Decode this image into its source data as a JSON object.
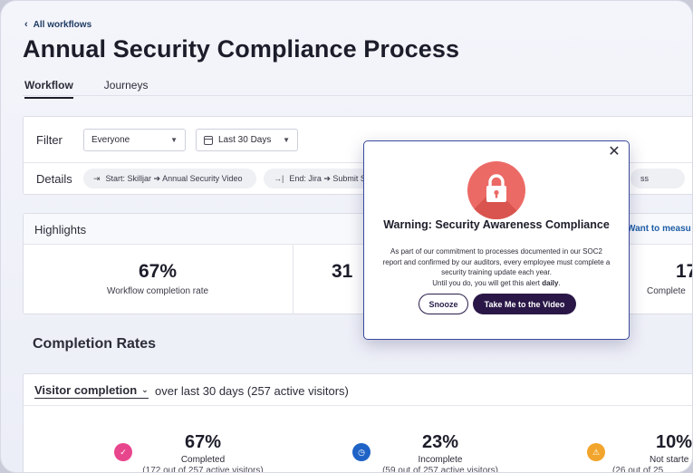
{
  "header": {
    "back_link": "All workflows",
    "title": "Annual Security Compliance Process",
    "tabs": [
      {
        "label": "Workflow",
        "active": true
      },
      {
        "label": "Journeys",
        "active": false
      }
    ]
  },
  "filter": {
    "label": "Filter",
    "audience": "Everyone",
    "date_range": "Last 30 Days",
    "details_label": "Details",
    "chips": [
      {
        "icon": "start-arrow-icon",
        "text": "Start: Skilljar ➔ Annual Security Video"
      },
      {
        "icon": "end-arrow-icon",
        "text": "End: Jira ➔ Submit S"
      },
      {
        "icon": "",
        "text": "ss"
      }
    ]
  },
  "highlights": {
    "title": "Highlights",
    "link": "Want to measu",
    "stats": [
      {
        "value": "67%",
        "label": "Workflow completion rate"
      },
      {
        "value": "31",
        "label": ""
      },
      {
        "value": "17",
        "label": "Complete"
      }
    ]
  },
  "completion": {
    "section_title": "Completion Rates",
    "metric_select": "Visitor completion",
    "description": "over last 30 days (257 active visitors)",
    "stats": [
      {
        "value": "67%",
        "label": "Completed",
        "sub": "(172 out of 257 active visitors)",
        "icon": "check-circle-icon",
        "color": "#e8468c"
      },
      {
        "value": "23%",
        "label": "Incomplete",
        "sub": "(59 out of 257 active visitors)",
        "icon": "clock-icon",
        "color": "#1f63c6"
      },
      {
        "value": "10%",
        "label": "Not starte",
        "sub": "(26 out of 25",
        "icon": "warning-icon",
        "color": "#f2a52c"
      }
    ]
  },
  "modal": {
    "title": "Warning: Security Awareness Compliance",
    "body_line1": "As part of our commitment to processes documented in our SOC2 report and confirmed by our auditors, every employee must complete a security training update each year.",
    "body_line2_prefix": "Until you do, you will get this alert ",
    "body_line2_bold": "daily",
    "body_line2_suffix": ".",
    "snooze_label": "Snooze",
    "primary_label": "Take Me to the Video",
    "close_glyph": "✕",
    "badge_color": "#ec6a66"
  }
}
